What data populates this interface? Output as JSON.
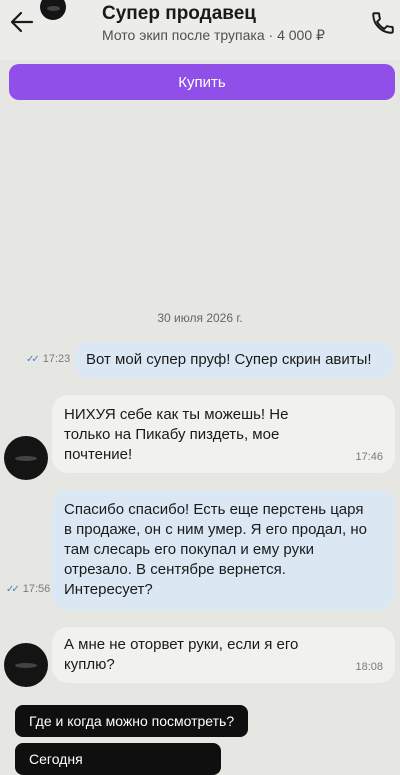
{
  "header": {
    "title": "Супер продавец",
    "subtitle": "Мото экип после трупака · 4 000 ₽"
  },
  "buy_button": {
    "label": "Купить"
  },
  "date_separator": "30 июля 2026 г.",
  "messages": [
    {
      "direction": "outgoing",
      "text": "Вот мой супер пруф! Супер скрин авиты!",
      "time": "17:23",
      "read": true
    },
    {
      "direction": "incoming",
      "text": "НИХУЯ себе как ты можешь! Не\nтолько на Пикабу пиздеть, мое\nпочтение!",
      "time": "17:46"
    },
    {
      "direction": "outgoing",
      "text": "Спасибо спасибо! Есть еще перстень царя\nв продаже, он с ним умер. Я его продал, но\nтам слесарь его покупал и ему руки\nотрезало. В сентябре вернется.\nИнтересует?",
      "time": "17:56",
      "read": true
    },
    {
      "direction": "incoming",
      "text": "А мне не оторвет руки, если я его\nкуплю?",
      "time": "18:08"
    }
  ],
  "quick_replies": [
    {
      "label": "Где и когда можно посмотреть?"
    },
    {
      "label": "Сегодня"
    }
  ],
  "colors": {
    "accent": "#8f4fe8",
    "outgoing_bubble": "#dbe8f4",
    "incoming_bubble": "#f1f1ee",
    "read_ticks": "#4a7fc0",
    "quick_reply_bg": "#0f0f0f"
  },
  "icons": [
    "back-arrow-icon",
    "phone-icon",
    "read-ticks-icon"
  ]
}
